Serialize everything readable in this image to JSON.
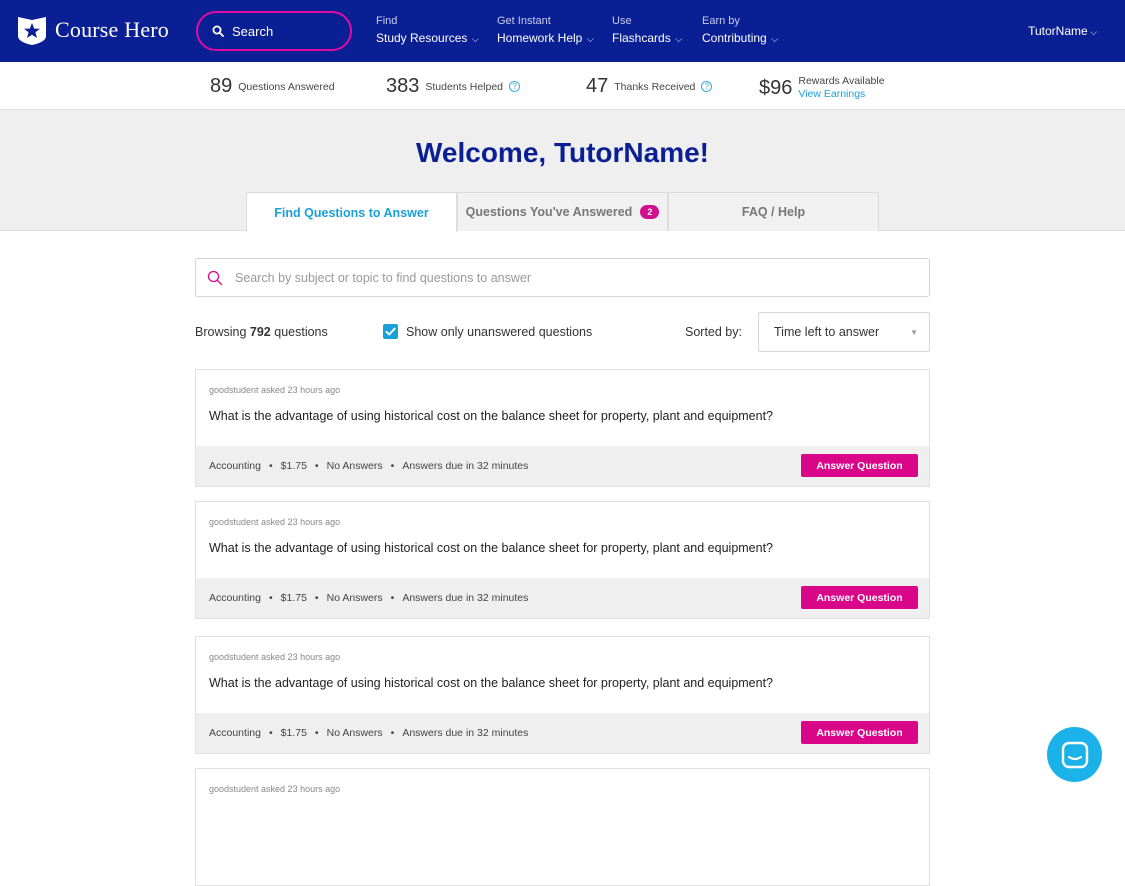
{
  "brand": {
    "name": "Course Hero"
  },
  "nav": {
    "search_label": "Search",
    "menus": [
      {
        "small": "Find",
        "big": "Study Resources"
      },
      {
        "small": "Get Instant",
        "big": "Homework Help"
      },
      {
        "small": "Use",
        "big": "Flashcards"
      },
      {
        "small": "Earn by",
        "big": "Contributing"
      }
    ],
    "user": "TutorName"
  },
  "stats": {
    "questions_answered": {
      "value": "89",
      "label": "Questions Answered"
    },
    "students_helped": {
      "value": "383",
      "label": "Students Helped"
    },
    "thanks_received": {
      "value": "47",
      "label": "Thanks Received"
    },
    "rewards": {
      "value": "$96",
      "label": "Rewards Available",
      "link": "View Earnings"
    }
  },
  "welcome": {
    "title": "Welcome, TutorName!"
  },
  "tabs": [
    {
      "label": "Find Questions to Answer",
      "active": true
    },
    {
      "label": "Questions You've Answered",
      "badge": "2"
    },
    {
      "label": "FAQ / Help"
    }
  ],
  "search": {
    "placeholder": "Search by subject or topic to find questions to answer",
    "value": ""
  },
  "filters": {
    "browsing_prefix": "Browsing",
    "browsing_count": "792",
    "browsing_suffix": "questions",
    "unanswered_label": "Show only unanswered questions",
    "unanswered_checked": true,
    "sorted_label": "Sorted by:",
    "sort_value": "Time left to answer"
  },
  "questions": [
    {
      "asked": "goodstudent asked 23 hours ago",
      "text": "What is the advantage of using historical cost on the balance sheet for property, plant and equipment?",
      "subject": "Accounting",
      "price": "$1.75",
      "answers": "No Answers",
      "due": "Answers due in 32 minutes",
      "button": "Answer Question"
    },
    {
      "asked": "goodstudent asked 23 hours ago",
      "text": "What is the advantage of using historical cost on the balance sheet for property, plant and equipment?",
      "subject": "Accounting",
      "price": "$1.75",
      "answers": "No Answers",
      "due": "Answers due in 32 minutes",
      "button": "Answer Question"
    },
    {
      "asked": "goodstudent asked 23 hours ago",
      "text": "What is the advantage of using historical cost on the balance sheet for property, plant and equipment?",
      "subject": "Accounting",
      "price": "$1.75",
      "answers": "No Answers",
      "due": "Answers due in 32 minutes",
      "button": "Answer Question"
    },
    {
      "asked": "goodstudent asked 23 hours ago"
    }
  ],
  "colors": {
    "nav_bg": "#0a1f94",
    "accent_pink": "#d9068a",
    "accent_blue": "#1aa0d8",
    "title_blue": "#0a1f94"
  },
  "icons": {
    "logo": "star-shield-icon",
    "search": "search-icon",
    "info": "info-icon",
    "chat": "chat-icon"
  }
}
